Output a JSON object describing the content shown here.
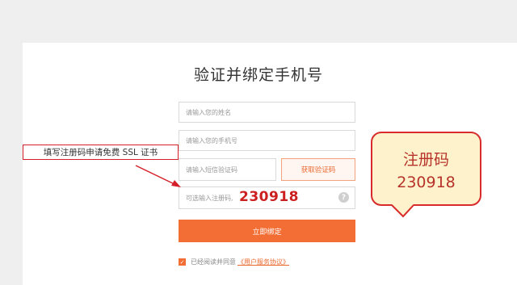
{
  "page": {
    "title": "验证并绑定手机号"
  },
  "form": {
    "name_placeholder": "请输入您的姓名",
    "phone_placeholder": "请输入您的手机号",
    "sms_placeholder": "请输入短信验证码",
    "sms_button": "获取验证码",
    "reg_placeholder": "可选输入注册码,",
    "reg_value_overlay": "230918",
    "help_icon": "?",
    "submit_label": "立即绑定"
  },
  "agreement": {
    "checked": true,
    "text": "已经阅读并同意",
    "link": "《用户服务协议》"
  },
  "annotation": {
    "hint": "填写注册码申请免费 SSL 证书",
    "bubble_label": "注册码",
    "bubble_code": "230918"
  },
  "colors": {
    "accent": "#f26e35",
    "annotation_red": "#d4202a",
    "bubble_fill": "#fdf2cb"
  }
}
